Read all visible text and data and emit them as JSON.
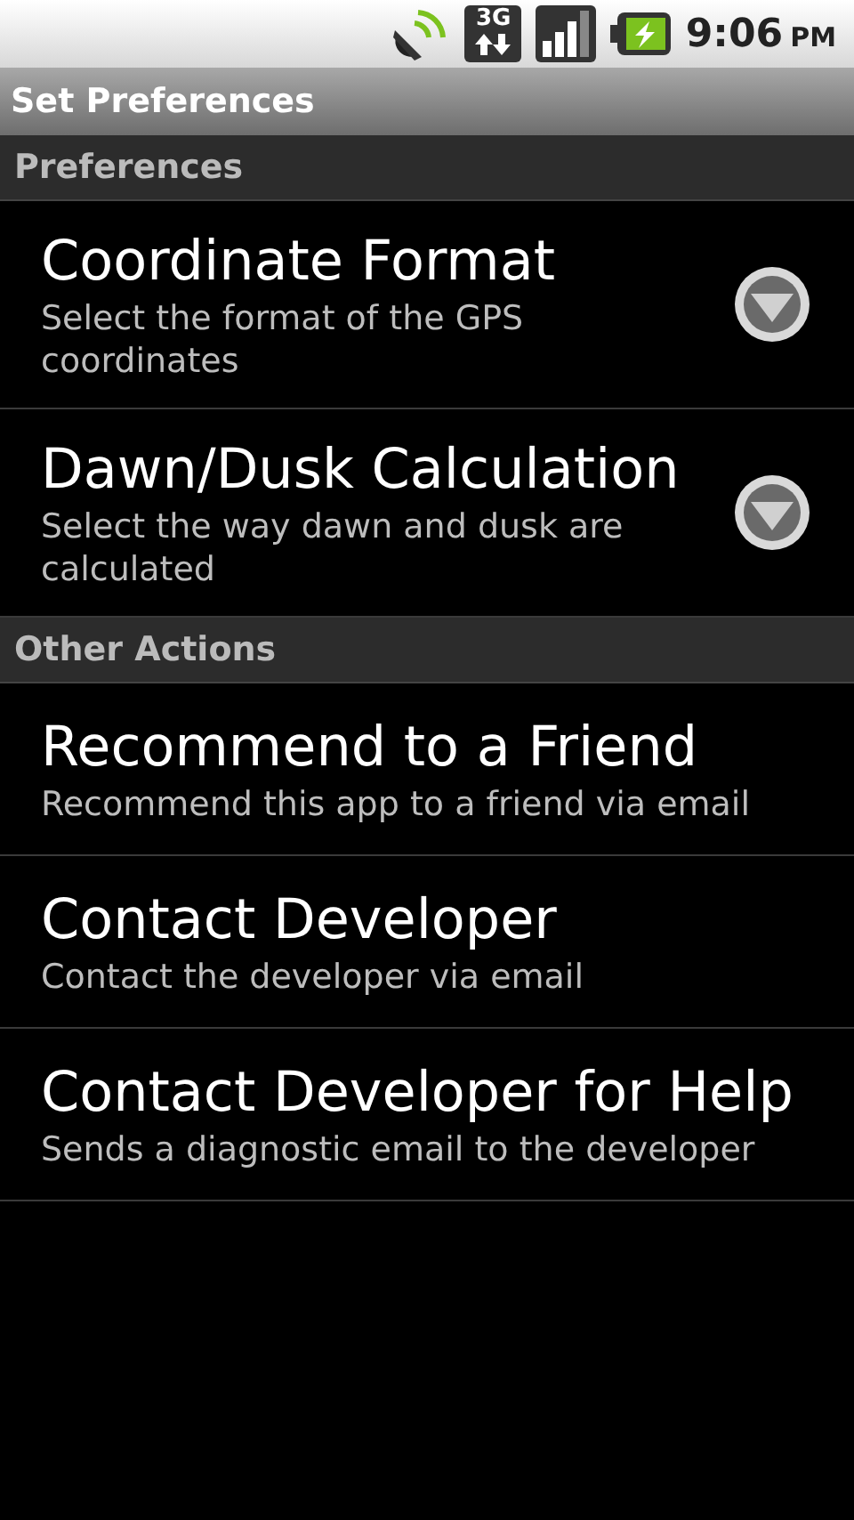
{
  "status_bar": {
    "network": "3G",
    "time": "9:06",
    "ampm": "PM"
  },
  "window": {
    "title": "Set Preferences"
  },
  "sections": [
    {
      "title": "Preferences",
      "items": [
        {
          "kind": "list",
          "title": "Coordinate Format",
          "summary": "Select the format of the GPS coordinates"
        },
        {
          "kind": "list",
          "title": "Dawn/Dusk Calculation",
          "summary": "Select the way dawn and dusk are calculated"
        }
      ]
    },
    {
      "title": "Other Actions",
      "items": [
        {
          "kind": "action",
          "title": "Recommend to a Friend",
          "summary": "Recommend this app to a friend via email"
        },
        {
          "kind": "action",
          "title": "Contact Developer",
          "summary": "Contact the developer via email"
        },
        {
          "kind": "action",
          "title": "Contact Developer for Help",
          "summary": "Sends a diagnostic email to the developer"
        }
      ]
    }
  ]
}
